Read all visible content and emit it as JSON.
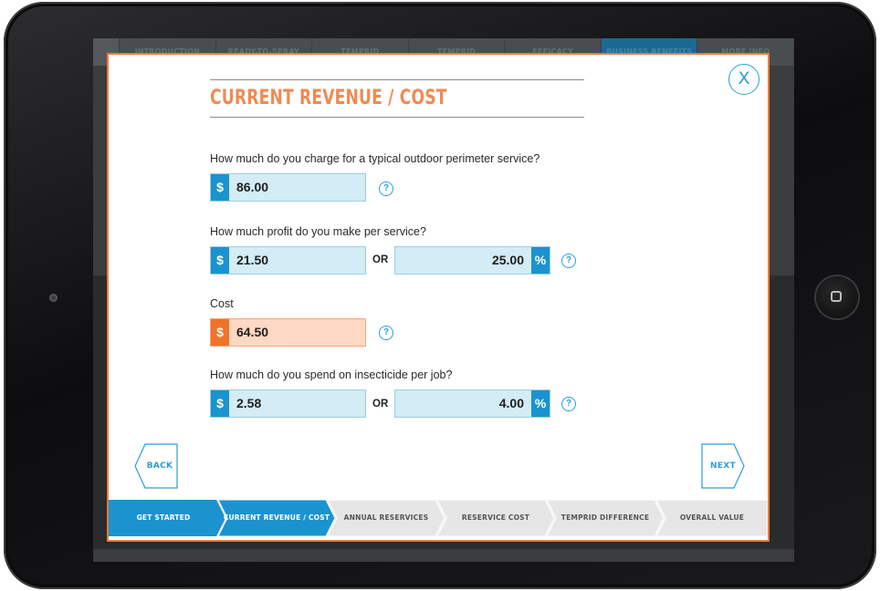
{
  "background_nav": {
    "items": [
      "INTRODUCTION",
      "READY-TO-SPRAY",
      "TEMPRID TECHNOLOGY",
      "TEMPRID APPLICATIONS",
      "EFFICACY",
      "BUSINESS BENEFITS",
      "MORE INFO"
    ],
    "active_index": 5
  },
  "modal": {
    "title": "CURRENT REVENUE / COST",
    "close_label": "X",
    "questions": {
      "charge": "How much do you charge for a typical outdoor perimeter service?",
      "profit": "How much profit do you make per service?",
      "cost": "Cost",
      "insecticide": "How much do you spend on insecticide per job?"
    },
    "fields": {
      "charge_dollars": "86.00",
      "profit_dollars": "21.50",
      "profit_percent": "25.00",
      "cost_dollars": "64.50",
      "insecticide_dollars": "2.58",
      "insecticide_percent": "4.00"
    },
    "currency_symbol": "$",
    "percent_symbol": "%",
    "or_label": "OR",
    "help_symbol": "?",
    "back_label": "BACK",
    "next_label": "NEXT",
    "steps": [
      "GET STARTED",
      "CURRENT REVENUE / COST",
      "ANNUAL RESERVICES",
      "RESERVICE COST",
      "TEMPRID DIFFERENCE",
      "OVERALL VALUE"
    ],
    "active_step_index": 1
  },
  "colors": {
    "accent_orange": "#f07a3c",
    "accent_blue": "#1a93cf",
    "step_inactive": "#e6e6e6"
  }
}
